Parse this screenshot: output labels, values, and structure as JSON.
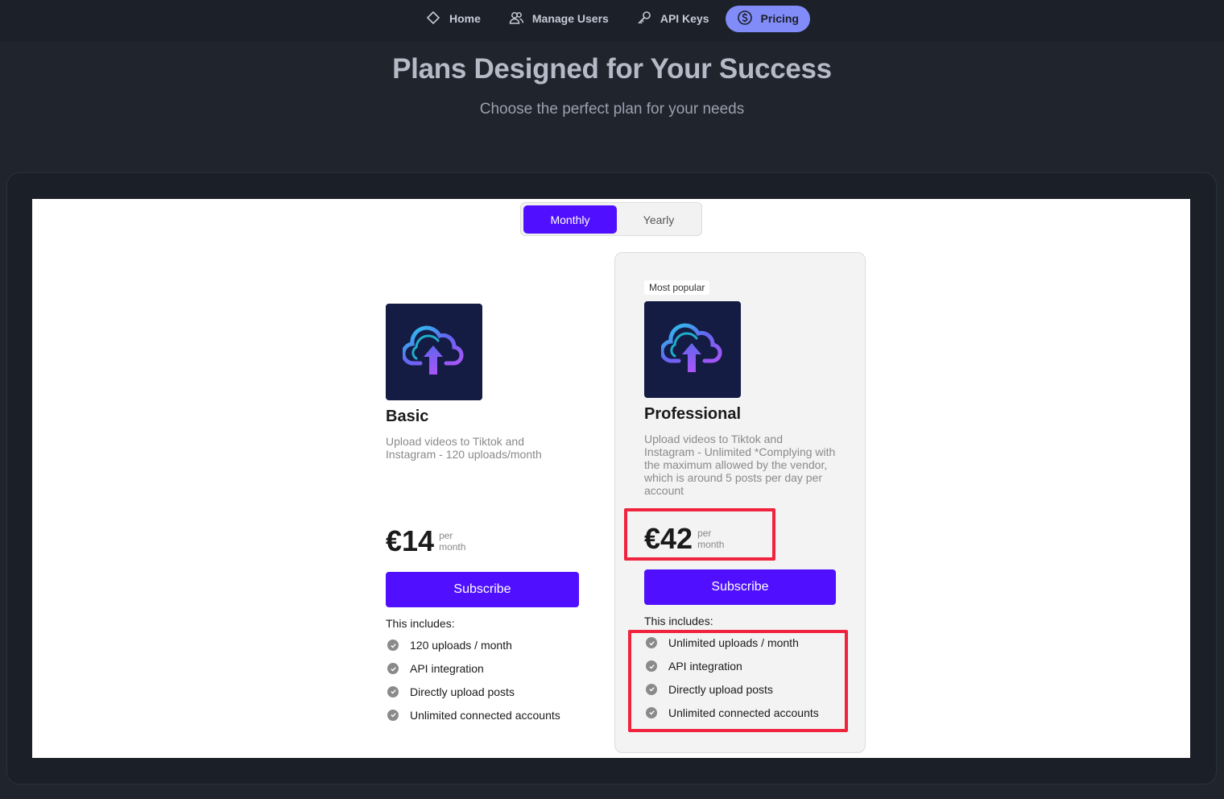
{
  "nav": {
    "items": [
      {
        "label": "Home",
        "icon": "home-icon"
      },
      {
        "label": "Manage Users",
        "icon": "users-icon"
      },
      {
        "label": "API Keys",
        "icon": "key-icon"
      },
      {
        "label": "Pricing",
        "icon": "dollar-circle-icon",
        "active": true
      }
    ]
  },
  "hero": {
    "title": "Plans Designed for Your Success",
    "subtitle": "Choose the perfect plan for your needs"
  },
  "billing_toggle": {
    "monthly": "Monthly",
    "yearly": "Yearly",
    "selected": "Monthly"
  },
  "plans": [
    {
      "name": "Basic",
      "description": "Upload videos to Tiktok and Instagram - 120 uploads/month",
      "price": "€14",
      "period": "per\nmonth",
      "subscribe": "Subscribe",
      "includes": "This includes:",
      "features": [
        "120 uploads / month",
        "API integration",
        "Directly upload posts",
        "Unlimited connected accounts"
      ]
    },
    {
      "badge": "Most popular",
      "name": "Professional",
      "description": "Upload videos to Tiktok and Instagram - Unlimited *Complying with the maximum allowed by the vendor, which is around 5 posts per day per account",
      "price": "€42",
      "period": "per\nmonth",
      "subscribe": "Subscribe",
      "includes": "This includes:",
      "features": [
        "Unlimited uploads / month",
        "API integration",
        "Directly upload posts",
        "Unlimited connected accounts"
      ]
    }
  ],
  "colors": {
    "accent": "#5010ff",
    "nav_active": "#818cf8",
    "highlight": "#f0233f",
    "background": "#1f242d"
  }
}
